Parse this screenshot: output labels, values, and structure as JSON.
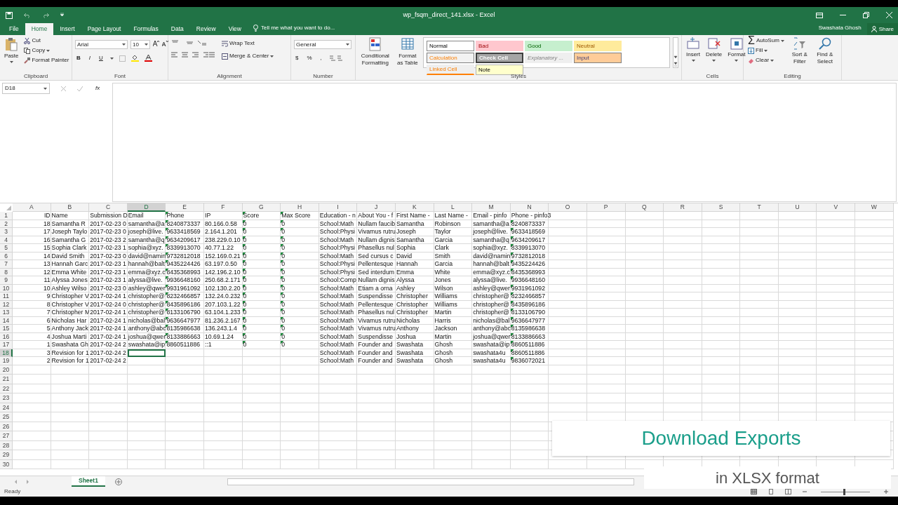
{
  "window": {
    "title": "wp_fsqm_direct_141.xlsx - Excel",
    "user": "Swashata Ghosh",
    "share": "Share"
  },
  "tabs": [
    {
      "label": "File",
      "selected": false
    },
    {
      "label": "Home",
      "selected": true
    },
    {
      "label": "Insert",
      "selected": false
    },
    {
      "label": "Page Layout",
      "selected": false
    },
    {
      "label": "Formulas",
      "selected": false
    },
    {
      "label": "Data",
      "selected": false
    },
    {
      "label": "Review",
      "selected": false
    },
    {
      "label": "View",
      "selected": false
    }
  ],
  "tell_me": "Tell me what you want to do...",
  "ribbon": {
    "clipboard": {
      "paste": "Paste",
      "cut": "Cut",
      "copy": "Copy",
      "format_painter": "Format Painter",
      "label": "Clipboard"
    },
    "font": {
      "name": "Arial",
      "size": "10",
      "bold": "B",
      "italic": "I",
      "underline": "U",
      "label": "Font"
    },
    "alignment": {
      "wrap": "Wrap Text",
      "merge": "Merge & Center",
      "label": "Alignment"
    },
    "number": {
      "format": "General",
      "currency": "$",
      "percent": "%",
      "comma": ",",
      "label": "Number"
    },
    "styles": {
      "conditional": "Conditional Formatting",
      "format_table": "Format as Table",
      "label": "Styles",
      "gallery": [
        {
          "label": "Normal",
          "kind": "normal"
        },
        {
          "label": "Bad",
          "kind": "bad"
        },
        {
          "label": "Good",
          "kind": "good"
        },
        {
          "label": "Neutral",
          "kind": "neutral"
        },
        {
          "label": "Calculation",
          "kind": "calculation"
        },
        {
          "label": "Check Cell",
          "kind": "check"
        },
        {
          "label": "Explanatory ...",
          "kind": "explanatory"
        },
        {
          "label": "Input",
          "kind": "input"
        },
        {
          "label": "Linked Cell",
          "kind": "linked"
        },
        {
          "label": "Note",
          "kind": "note"
        }
      ]
    },
    "cells": {
      "buttons": [
        "Insert",
        "Delete",
        "Format"
      ],
      "label": "Cells"
    },
    "editing": {
      "autosum_symbol": "Σ",
      "autosum": "AutoSum",
      "fill": "Fill",
      "clear": "Clear",
      "sort": "Sort & Filter",
      "find": "Find & Select",
      "label": "Editing"
    }
  },
  "formula_bar": {
    "name_box": "D18",
    "fx": "fx"
  },
  "grid": {
    "columns": [
      {
        "label": "A",
        "selected": false,
        "right_aligned": true,
        "flagged": false
      },
      {
        "label": "B",
        "selected": false,
        "right_aligned": false,
        "flagged": false
      },
      {
        "label": "C",
        "selected": false,
        "right_aligned": false,
        "flagged": false
      },
      {
        "label": "D",
        "selected": true,
        "right_aligned": false,
        "flagged": false
      },
      {
        "label": "E",
        "selected": false,
        "right_aligned": false,
        "flagged": true
      },
      {
        "label": "F",
        "selected": false,
        "right_aligned": false,
        "flagged": false
      },
      {
        "label": "G",
        "selected": false,
        "right_aligned": false,
        "flagged": true
      },
      {
        "label": "H",
        "selected": false,
        "right_aligned": false,
        "flagged": true
      },
      {
        "label": "I",
        "selected": false,
        "right_aligned": false,
        "flagged": false
      },
      {
        "label": "J",
        "selected": false,
        "right_aligned": false,
        "flagged": false
      },
      {
        "label": "K",
        "selected": false,
        "right_aligned": false,
        "flagged": false
      },
      {
        "label": "L",
        "selected": false,
        "right_aligned": false,
        "flagged": false
      },
      {
        "label": "M",
        "selected": false,
        "right_aligned": false,
        "flagged": false
      },
      {
        "label": "N",
        "selected": false,
        "right_aligned": false,
        "flagged": true
      },
      {
        "label": "O",
        "selected": false
      },
      {
        "label": "P",
        "selected": false
      },
      {
        "label": "Q",
        "selected": false
      },
      {
        "label": "R",
        "selected": false
      },
      {
        "label": "S",
        "selected": false
      },
      {
        "label": "T",
        "selected": false
      },
      {
        "label": "U",
        "selected": false
      },
      {
        "label": "V",
        "selected": false
      },
      {
        "label": "W",
        "selected": false
      }
    ],
    "rows": [
      {
        "label": "1",
        "selected": false,
        "cells": [
          "ID",
          "Name",
          "Submission D",
          "Email",
          "Phone",
          "IP",
          "Score",
          "Max Score",
          "Education - n",
          "About You - f",
          "First Name -",
          "Last Name -",
          "Email - pinfo",
          "Phone - pinfo3"
        ]
      },
      {
        "label": "2",
        "selected": false,
        "cells": [
          "18",
          "Samantha R",
          "2017-02-23 0",
          "samantha@a",
          "8240873337",
          "80.166.0.58",
          "0",
          "0",
          "School:Math",
          "Nullam faucib",
          "Samantha",
          "Robinson",
          "samantha@a",
          "8240873337"
        ]
      },
      {
        "label": "3",
        "selected": false,
        "cells": [
          "17",
          "Joseph Taylo",
          "2017-02-23 0",
          "joseph@live.",
          "9633418569",
          "2.164.1.201",
          "0",
          "0",
          "School:Physi",
          "Vivamus rutru",
          "Joseph",
          "Taylor",
          "joseph@live.",
          "9633418569"
        ]
      },
      {
        "label": "4",
        "selected": false,
        "cells": [
          "16",
          "Samantha G",
          "2017-02-23 2",
          "samantha@q",
          "9634209617",
          "238.229.0.10",
          "0",
          "0",
          "School:Math",
          "Nullam dignis",
          "Samantha",
          "Garcia",
          "samantha@q",
          "9634209617"
        ]
      },
      {
        "label": "5",
        "selected": false,
        "cells": [
          "15",
          "Sophia Clark",
          "2017-02-23 1",
          "sophia@xyz.",
          "8339913070",
          "40.77.1.22",
          "0",
          "0",
          "School:Physi",
          "Phasellus nul",
          "Sophia",
          "Clark",
          "sophia@xyz.",
          "8339913070"
        ]
      },
      {
        "label": "6",
        "selected": false,
        "cells": [
          "14",
          "David Smith",
          "2017-02-23 0",
          "david@namin",
          "9732812018",
          "152.169.0.21",
          "0",
          "0",
          "School:Math",
          "Sed cursus c",
          "David",
          "Smith",
          "david@namin",
          "9732812018"
        ]
      },
      {
        "label": "7",
        "selected": false,
        "cells": [
          "13",
          "Hannah Garc",
          "2017-02-23 1",
          "hannah@balt",
          "9435224426",
          "63.197.0.50",
          "0",
          "0",
          "School:Physi",
          "Pellentesque",
          "Hannah",
          "Garcia",
          "hannah@balt",
          "9435224426"
        ]
      },
      {
        "label": "8",
        "selected": false,
        "cells": [
          "12",
          "Emma White",
          "2017-02-23 1",
          "emma@xyz.c",
          "8435368993",
          "142.196.2.10",
          "0",
          "0",
          "School:Physi",
          "Sed interdum",
          "Emma",
          "White",
          "emma@xyz.c",
          "8435368993"
        ]
      },
      {
        "label": "9",
        "selected": false,
        "cells": [
          "11",
          "Alyssa Jones",
          "2017-02-23 1",
          "alyssa@live.",
          "9936648160",
          "250.68.2.171",
          "0",
          "0",
          "School:Comp",
          "Nullam dignis",
          "Alyssa",
          "Jones",
          "alyssa@live.",
          "9936648160"
        ]
      },
      {
        "label": "10",
        "selected": false,
        "cells": [
          "10",
          "Ashley Wilso",
          "2017-02-23 0",
          "ashley@qwer",
          "9931961092",
          "102.130.2.20",
          "0",
          "0",
          "School:Math",
          "Etiam a orna",
          "Ashley",
          "Wilson",
          "ashley@qwer",
          "9931961092"
        ]
      },
      {
        "label": "11",
        "selected": false,
        "cells": [
          "9",
          "Christopher V",
          "2017-02-24 1",
          "christopher@",
          "8232466857",
          "132.24.0.232",
          "0",
          "0",
          "School:Math",
          "Suspendisse",
          "Christopher",
          "Williams",
          "christopher@",
          "8232466857"
        ]
      },
      {
        "label": "12",
        "selected": false,
        "cells": [
          "8",
          "Christopher V",
          "2017-02-24 0",
          "christopher@",
          "8435896186",
          "207.103.1.22",
          "0",
          "0",
          "School:Math",
          "Pellentesque",
          "Christopher",
          "Williams",
          "christopher@",
          "8435896186"
        ]
      },
      {
        "label": "13",
        "selected": false,
        "cells": [
          "7",
          "Christopher M",
          "2017-02-24 1",
          "christopher@",
          "8133106790",
          "63.104.1.233",
          "0",
          "0",
          "School:Math",
          "Phasellus nul",
          "Christopher",
          "Martin",
          "christopher@",
          "8133106790"
        ]
      },
      {
        "label": "14",
        "selected": false,
        "cells": [
          "6",
          "Nicholas Har",
          "2017-02-24 1",
          "nicholas@bal",
          "9636647977",
          "81.236.2.167",
          "0",
          "0",
          "School:Math",
          "Vivamus rutru",
          "Nicholas",
          "Harris",
          "nicholas@bal",
          "9636647977"
        ]
      },
      {
        "label": "15",
        "selected": false,
        "cells": [
          "5",
          "Anthony Jack",
          "2017-02-24 1",
          "anthony@abc",
          "8135986638",
          "136.243.1.4",
          "0",
          "0",
          "School:Math",
          "Vivamus rutru",
          "Anthony",
          "Jackson",
          "anthony@abc",
          "8135986638"
        ]
      },
      {
        "label": "16",
        "selected": false,
        "cells": [
          "4",
          "Joshua Marti",
          "2017-02-24 1",
          "joshua@qwer",
          "8133886663",
          "10.69.1.24",
          "0",
          "0",
          "School:Math",
          "Suspendisse",
          "Joshua",
          "Martin",
          "joshua@qwer",
          "8133886663"
        ]
      },
      {
        "label": "17",
        "selected": false,
        "cells": [
          "1",
          "Swashata Gh",
          "2017-02-24 2",
          "swashata@ip",
          "8860511886",
          "::1",
          "0",
          "0",
          "School:Math",
          "Founder and",
          "Swashata",
          "Ghosh",
          "swashata@ip",
          "8860511886"
        ]
      },
      {
        "label": "18",
        "selected": true,
        "cells": [
          "3",
          "Revision for 1",
          "2017-02-24 2",
          "",
          "",
          "",
          "",
          "",
          "School:Math",
          "Founder and",
          "Swashata",
          "Ghosh",
          "swashata4u",
          "8860511886"
        ]
      },
      {
        "label": "19",
        "selected": false,
        "cells": [
          "2",
          "Revision for 1",
          "2017-02-24 2",
          "",
          "",
          "",
          "",
          "",
          "School:Math",
          "Founder and",
          "Swashata",
          "Ghosh",
          "swashata4u",
          "9836072021"
        ]
      },
      {
        "label": "20",
        "selected": false
      },
      {
        "label": "21",
        "selected": false
      },
      {
        "label": "22",
        "selected": false
      },
      {
        "label": "23",
        "selected": false
      },
      {
        "label": "24",
        "selected": false
      },
      {
        "label": "25",
        "selected": false
      },
      {
        "label": "26",
        "selected": false
      },
      {
        "label": "27",
        "selected": false
      },
      {
        "label": "28",
        "selected": false
      },
      {
        "label": "29",
        "selected": false
      },
      {
        "label": "30",
        "selected": false
      }
    ]
  },
  "sheets": [
    {
      "label": "Sheet1",
      "selected": true
    }
  ],
  "status_bar": {
    "text": "Ready",
    "zoom": {
      "level": 0.45
    }
  },
  "caption": {
    "title": "Download Exports",
    "subtitle": "in XLSX format"
  }
}
